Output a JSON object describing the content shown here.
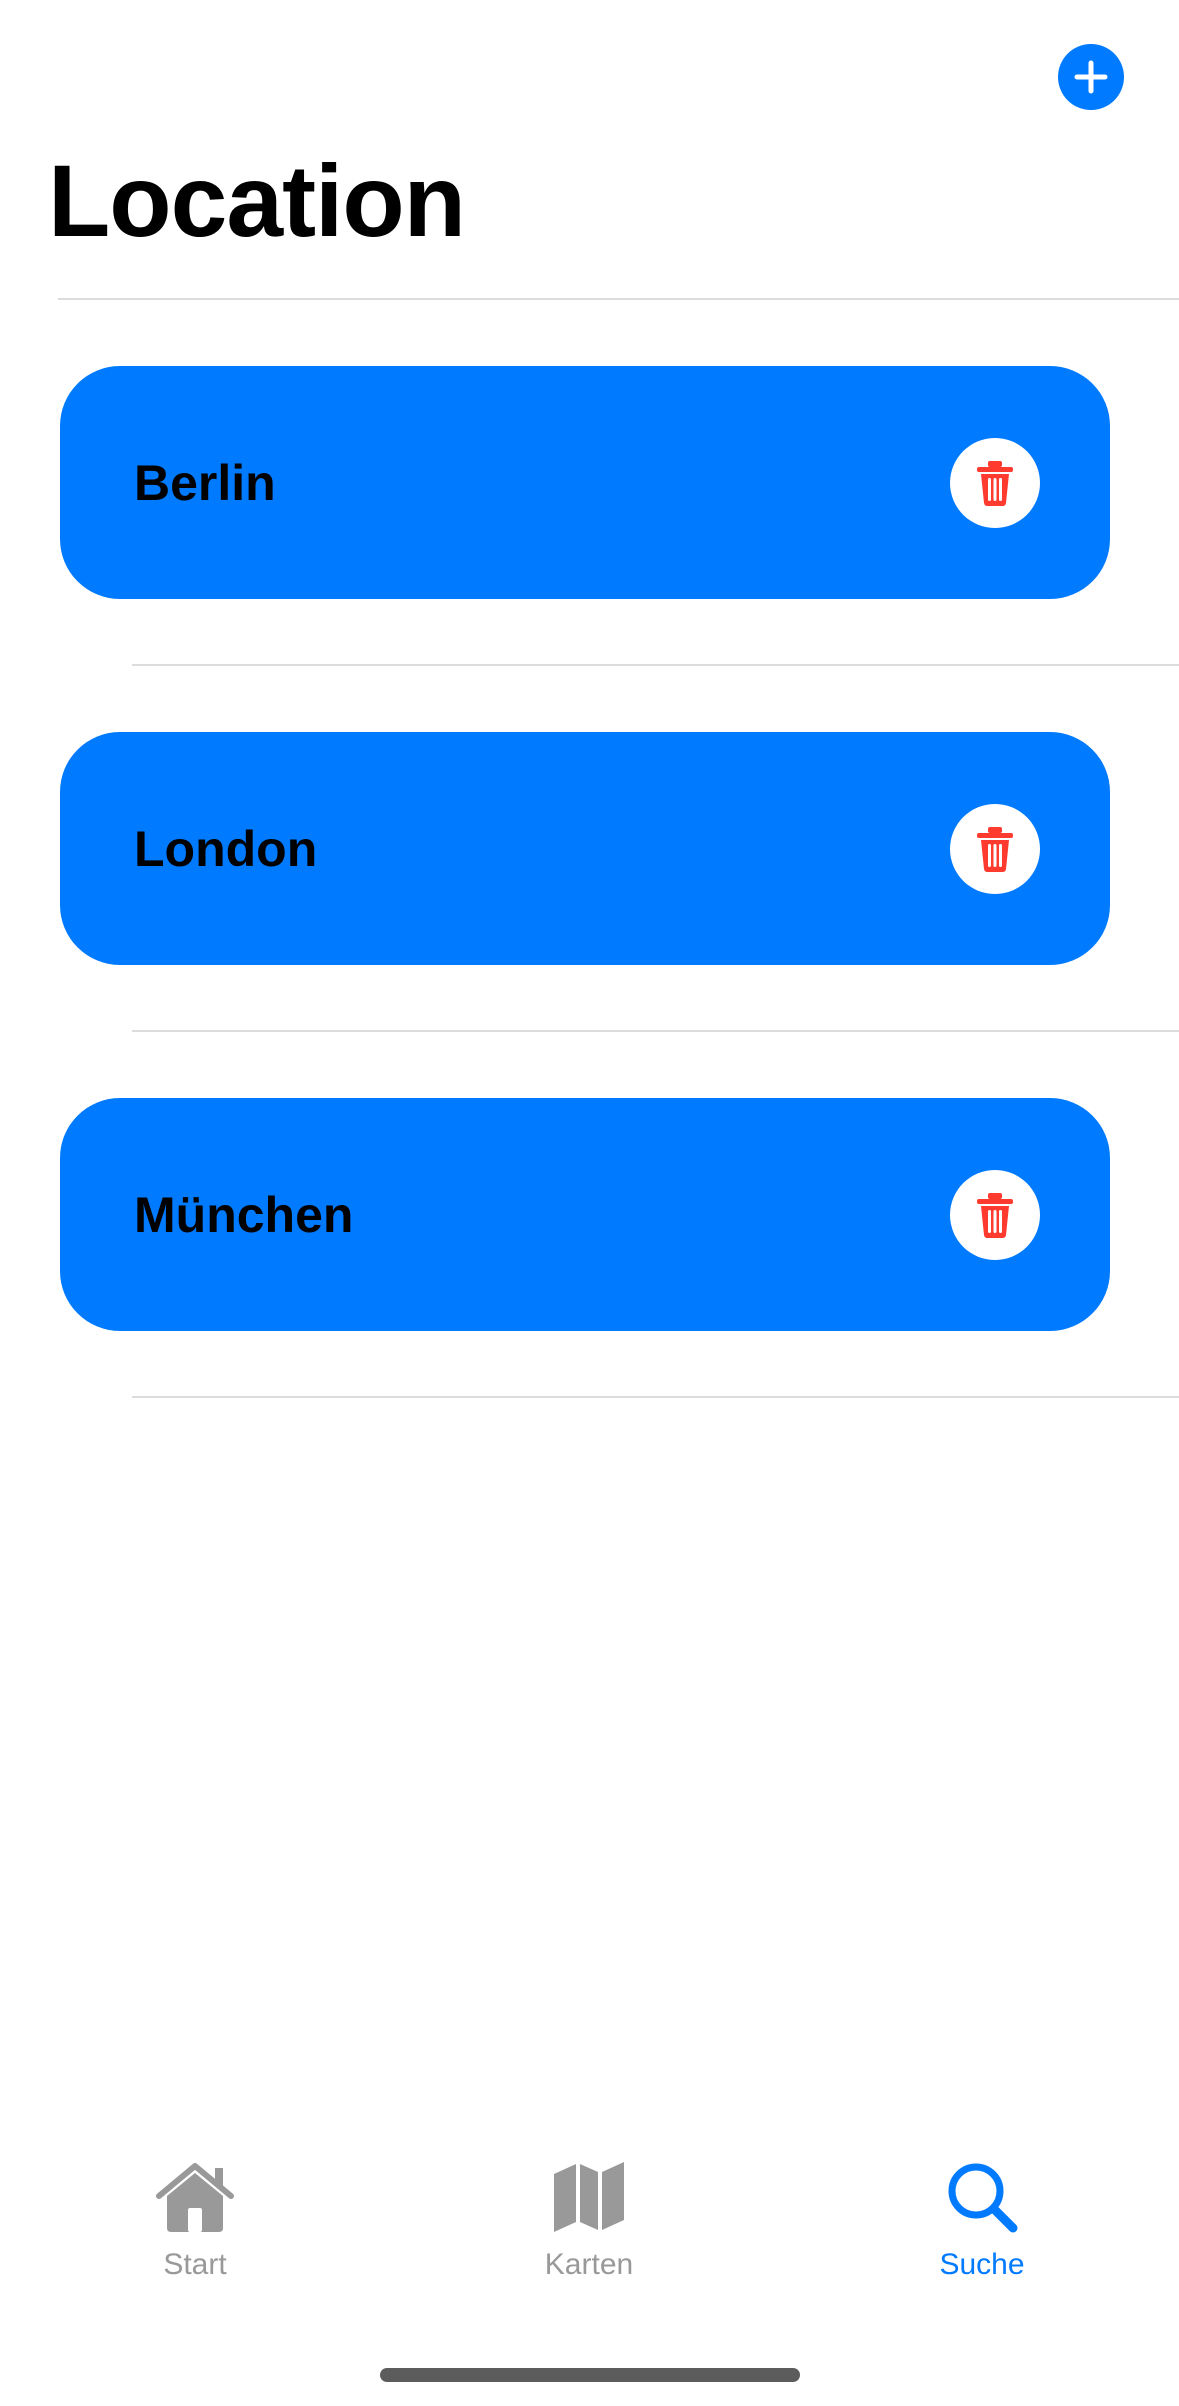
{
  "header": {
    "title": "Location",
    "add_icon": "plus-circle-icon"
  },
  "locations": [
    {
      "name": "Berlin"
    },
    {
      "name": "London"
    },
    {
      "name": "München"
    }
  ],
  "tabbar": {
    "tabs": [
      {
        "label": "Start",
        "icon": "house-icon",
        "active": false
      },
      {
        "label": "Karten",
        "icon": "map-icon",
        "active": false
      },
      {
        "label": "Suche",
        "icon": "search-icon",
        "active": true
      }
    ]
  },
  "colors": {
    "accent": "#007aff",
    "delete": "#ff3b30",
    "tab_inactive": "#999999"
  }
}
